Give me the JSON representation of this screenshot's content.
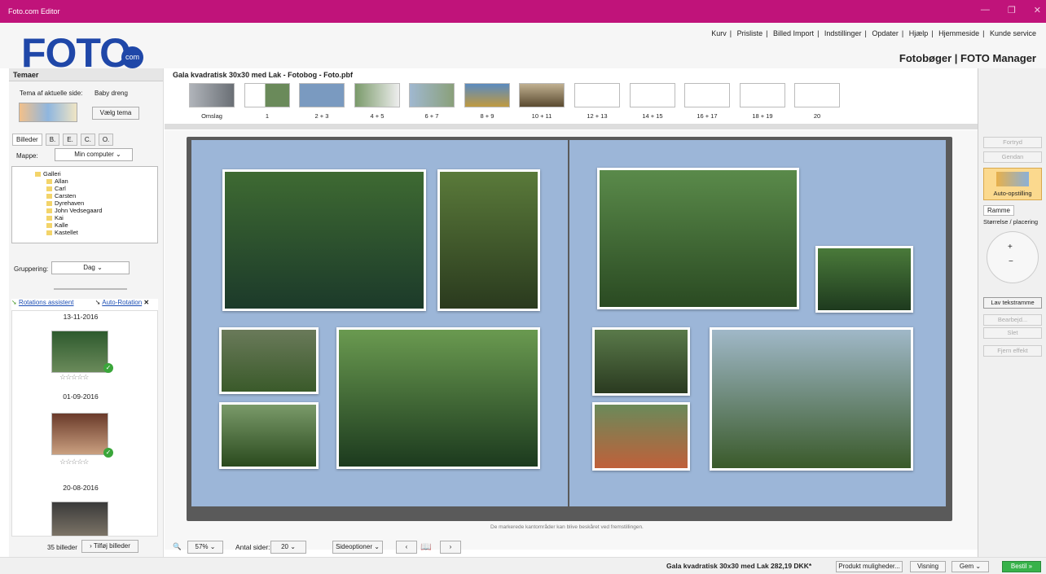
{
  "window": {
    "title": "Foto.com Editor"
  },
  "header": {
    "logo": "FOTO",
    "logo_badge": "com",
    "links": [
      "Kurv",
      "Prisliste",
      "Billed Import",
      "Indstillinger",
      "Opdater",
      "Hjælp",
      "Hjemmeside",
      "Kunde service"
    ],
    "brand": "Fotobøger  |  FOTO Manager"
  },
  "left": {
    "section_title": "Temaer",
    "tema_label": "Tema af aktuelle side:",
    "tema_value": "Baby dreng",
    "choose_theme": "Vælg tema",
    "tabs": [
      "Billeder",
      "B.",
      "E.",
      "C.",
      "O."
    ],
    "folder_label": "Mappe:",
    "folder_value": "Min computer",
    "tree": [
      "Galleri",
      "Allan",
      "Carl",
      "Carsten",
      "Dyrehaven",
      "John Vedsegaard",
      "Kai",
      "Kalle",
      "Kastellet"
    ],
    "grouping_label": "Gruppering:",
    "grouping_value": "Dag",
    "rotation_assistant": "Rotations assistent",
    "auto_rotation": "Auto-Rotation",
    "dates": [
      "13-11-2016",
      "01-09-2016",
      "20-08-2016"
    ],
    "count": "35 billeder",
    "add_images": "Tilføj billeder"
  },
  "center": {
    "document_title": "Gala kvadratisk 30x30 med Lak - Fotobog - Foto.pbf",
    "pages": [
      "Omslag",
      "1",
      "2 + 3",
      "4 + 5",
      "6 + 7",
      "8 + 9",
      "10 + 11",
      "12 + 13",
      "14 + 15",
      "16 + 17",
      "18 + 19",
      "20"
    ],
    "note": "De markerede kantområder kan blive beskåret ved fremstillingen.",
    "zoom": "57%",
    "pages_label": "Antal sider:",
    "pages_value": "20",
    "page_options": "Sideoptioner"
  },
  "right": {
    "undo": "Fortryd",
    "redo": "Gendan",
    "auto": "Auto-opstilling",
    "frame_tab": "Ramme",
    "size_label": "Størrelse / placering",
    "text_frame": "Lav tekstramme",
    "edit": "Bearbejd...",
    "delete": "Slet",
    "remove_effect": "Fjern effekt"
  },
  "status": {
    "price": "Gala kvadratisk 30x30 med Lak 282,19 DKK*",
    "product_options": "Produkt muligheder...",
    "view": "Visning",
    "save": "Gem",
    "order": "Bestil"
  },
  "colors": {
    "titlebar": "#c0137a",
    "logo": "#1f47a8",
    "page_bg": "#9cb6d8",
    "order_btn": "#37b24a"
  }
}
